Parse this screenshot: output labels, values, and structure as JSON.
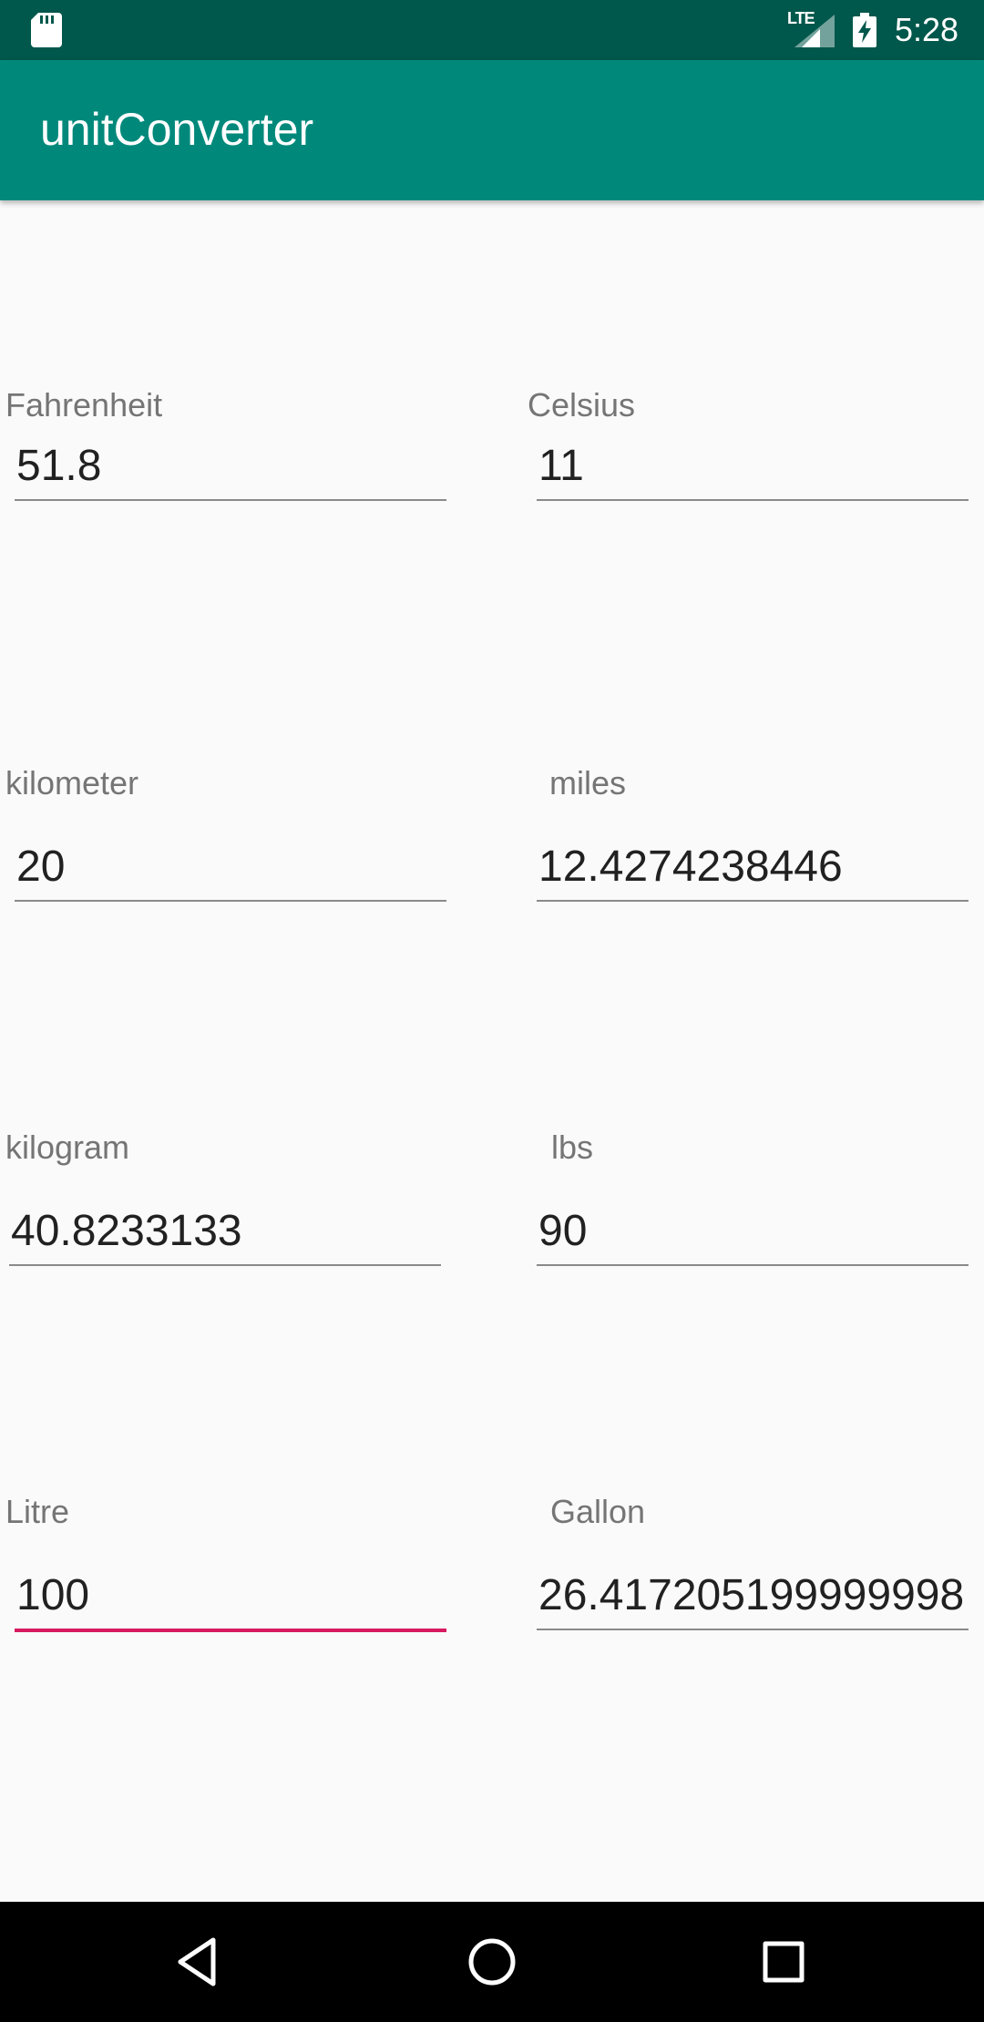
{
  "status_bar": {
    "time": "5:28",
    "network": "LTE",
    "icons": [
      "sd-card-icon",
      "signal-icon",
      "battery-charging-icon"
    ]
  },
  "app_bar": {
    "title": "unitConverter",
    "color": "#00897b"
  },
  "converters": [
    {
      "left": {
        "label": "Fahrenheit",
        "value": "51.8"
      },
      "right": {
        "label": "Celsius",
        "value": "11"
      }
    },
    {
      "left": {
        "label": "kilometer",
        "value": "20"
      },
      "right": {
        "label": "miles",
        "value": "12.4274238446"
      }
    },
    {
      "left": {
        "label": "kilogram",
        "value": "40.8233133"
      },
      "right": {
        "label": "lbs",
        "value": "90"
      }
    },
    {
      "left": {
        "label": "Litre",
        "value": "100",
        "focused": true
      },
      "right": {
        "label": "Gallon",
        "value": "26.417205199999998"
      }
    }
  ],
  "colors": {
    "status_bar": "#00574b",
    "accent": "#d81b60",
    "background": "#fafafa"
  },
  "nav_bar": {
    "icons": [
      "back-icon",
      "home-icon",
      "recents-icon"
    ]
  }
}
